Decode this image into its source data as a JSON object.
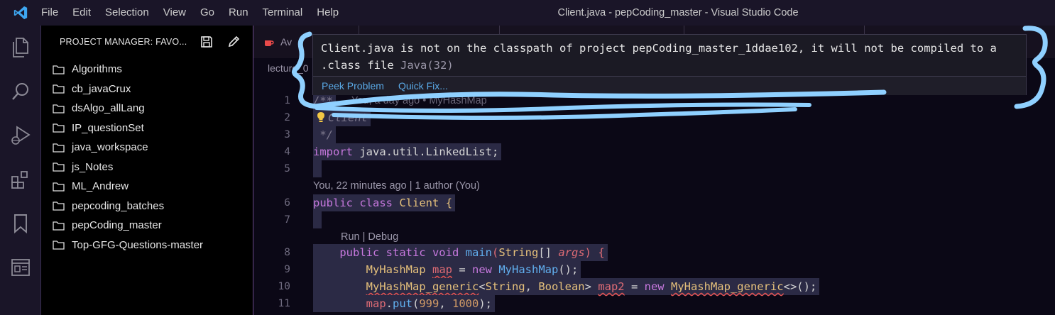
{
  "window": {
    "title": "Client.java - pepCoding_master - Visual Studio Code",
    "menu": [
      "File",
      "Edit",
      "Selection",
      "View",
      "Go",
      "Run",
      "Terminal",
      "Help"
    ]
  },
  "activity_bar": [
    "explorer-icon",
    "search-icon",
    "run-debug-icon",
    "extensions-icon",
    "bookmark-icon",
    "project-manager-icon"
  ],
  "sidebar": {
    "title": "PROJECT MANAGER: FAVO...",
    "folders": [
      "Algorithms",
      "cb_javaCrux",
      "dsAlgo_allLang",
      "IP_questionSet",
      "java_workspace",
      "js_Notes",
      "ML_Andrew",
      "pepcoding_batches",
      "pepCoding_master",
      "Top-GFG-Questions-master"
    ]
  },
  "tabs": {
    "first_partial": "Av",
    "breadcrumb_partial": "lecture_0"
  },
  "hover": {
    "message_line1": "Client.java is not on the classpath of project pepCoding_master_1ddae102, it will not be compiled to a",
    "message_line2": ".class file",
    "source": "Java(32)",
    "peek_problem": "Peek Problem",
    "quick_fix": "Quick Fix..."
  },
  "codelens": {
    "blame_top": "You, a day ago • MyHashMap",
    "authors": "You, 22 minutes ago | 1 author (You)",
    "run_debug": "Run | Debug"
  },
  "code_lines": {
    "n1": "1",
    "n2": "2",
    "n3": "3",
    "n4": "4",
    "n5": "5",
    "n6": "6",
    "n7": "7",
    "n8": "8",
    "n9": "9",
    "n10": "10",
    "n11": "11",
    "l1": "/**",
    "l2": "Client",
    "l3": " */",
    "l4_kw": "import",
    "l4_rest": " java.util.LinkedList;",
    "l6_kw1": "public",
    "l6_kw2": "class",
    "l6_name": "Client",
    "l6_brace": " {",
    "l8_kw": "public static void",
    "l8_fn": "main",
    "l8_open": "(",
    "l8_type": "String",
    "l8_arr": "[] ",
    "l8_param": "args",
    "l8_close": ") {",
    "l9_type": "MyHashMap",
    "l9_var": "map",
    "l9_eq": " = ",
    "l9_new": "new",
    "l9_ctor": "MyHashMap",
    "l9_end": "();",
    "l10_type": "MyHashMap_generic",
    "l10_gen1": "<",
    "l10_g1": "String",
    "l10_comma": ", ",
    "l10_g2": "Boolean",
    "l10_gen2": "> ",
    "l10_var": "map2",
    "l10_eq": " = ",
    "l10_new": "new",
    "l10_ctor": "MyHashMap_generic",
    "l10_end": "<>();",
    "l11_var": "map",
    "l11_dot": ".",
    "l11_fn": "put",
    "l11_open": "(",
    "l11_a": "999",
    "l11_comma": ", ",
    "l11_b": "1000",
    "l11_end": ");"
  }
}
